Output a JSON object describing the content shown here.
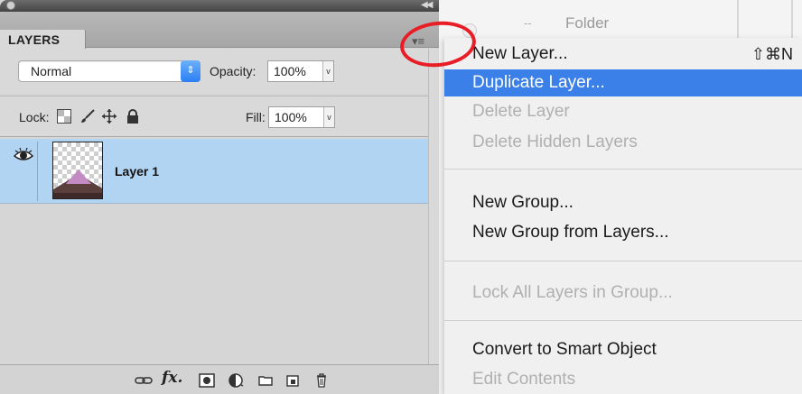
{
  "background_window": {
    "folder_label": "Folder",
    "dash": "--"
  },
  "panel": {
    "tab_label": "LAYERS",
    "menu_button_glyph": "▾≡",
    "blend_mode": "Normal",
    "opacity_label": "Opacity:",
    "opacity_value": "100%",
    "lock_label": "Lock:",
    "fill_label": "Fill:",
    "fill_value": "100%",
    "layers": [
      {
        "name": "Layer 1",
        "visible": true,
        "selected": true
      }
    ],
    "bottom_icons": [
      "link-icon",
      "fx-icon",
      "mask-icon",
      "adjustment-icon",
      "folder-icon",
      "new-layer-icon",
      "trash-icon"
    ],
    "fx_glyph": "fx."
  },
  "menu": {
    "items": [
      {
        "label": "New Layer...",
        "shortcut": "⇧⌘N",
        "state": "normal"
      },
      {
        "label": "Duplicate Layer...",
        "state": "selected"
      },
      {
        "label": "Delete Layer",
        "state": "disabled"
      },
      {
        "label": "Delete Hidden Layers",
        "state": "disabled"
      },
      {
        "label": "New Group...",
        "state": "normal"
      },
      {
        "label": "New Group from Layers...",
        "state": "normal"
      },
      {
        "label": "Lock All Layers in Group...",
        "state": "disabled"
      },
      {
        "label": "Convert to Smart Object",
        "state": "normal"
      },
      {
        "label": "Edit Contents",
        "state": "disabled"
      }
    ]
  },
  "colors": {
    "selection_blue": "#3a80e8",
    "layer_highlight": "#b2d4f3",
    "annotation_red": "#e81d25"
  }
}
